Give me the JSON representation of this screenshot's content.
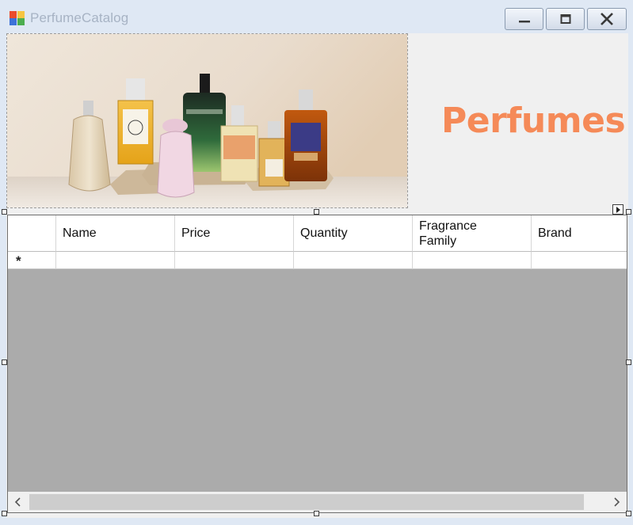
{
  "window": {
    "title": "PerfumeCatalog",
    "controls": [
      "minimize",
      "maximize",
      "close"
    ]
  },
  "header": {
    "heading": "Perfumes",
    "heading_color": "#f58a58",
    "image_alt": "perfume bottles on stone blocks"
  },
  "grid": {
    "columns": [
      "Name",
      "Price",
      "Quantity",
      "Fragrance Family",
      "Brand"
    ],
    "new_row_marker": "*",
    "rows": []
  },
  "colors": {
    "titlebar": "#dfe8f4",
    "form_background": "#f0f0f0",
    "grid_background": "#ababab",
    "accent": "#f58a58"
  }
}
